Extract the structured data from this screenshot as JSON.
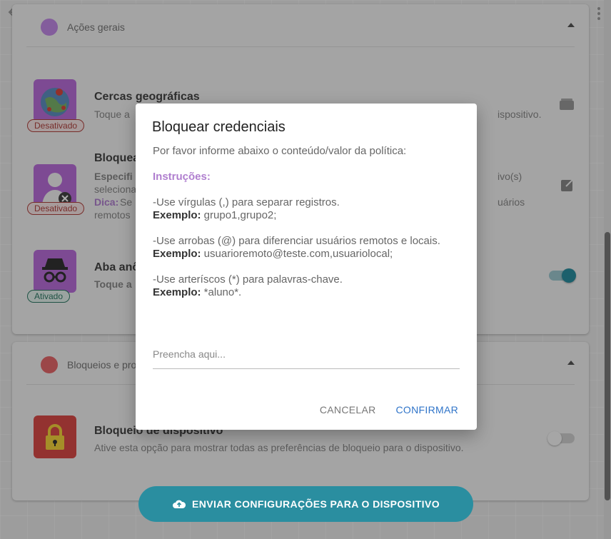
{
  "colors": {
    "accent": "#2a8ea0",
    "dialog_link": "#2f74c9",
    "instructions": "#b07fcf",
    "badge_off": "#b0433f",
    "badge_on": "#2f7a66",
    "section_general": "#c189e6",
    "section_blocks": "#e5676a"
  },
  "sections": [
    {
      "label": "Ações gerais",
      "items": [
        {
          "title": "Cercas geográficas",
          "desc_visible_prefix": "Toque a",
          "desc_visible_suffix": "ispositivo.",
          "badge": "Desativado",
          "icon": "map-globe-icon"
        },
        {
          "title": "Bloquea",
          "desc_line1_prefix": "Especifi",
          "desc_line1_suffix": "ivo(s)",
          "desc_line2": "seleciona",
          "tip_label": "Dica:",
          "tip_prefix": "Se",
          "tip_suffix": "uários",
          "desc_line4": "remotos",
          "badge": "Desativado",
          "icon": "user-blocked-icon"
        },
        {
          "title": "Aba anô",
          "desc_visible_prefix": "Toque a",
          "badge": "Ativado",
          "icon": "incognito-icon",
          "toggle_on": true
        }
      ]
    },
    {
      "label": "Bloqueios e proteç",
      "items": [
        {
          "title": "Bloqueio de dispositivo",
          "desc": "Ative esta opção para mostrar todas as preferências de bloqueio para o dispositivo.",
          "icon": "lock-icon",
          "toggle_on": false
        }
      ]
    }
  ],
  "fab_label": "ENVIAR CONFIGURAÇÕES PARA O DISPOSITIVO",
  "dialog": {
    "title": "Bloquear credenciais",
    "intro": "Por favor informe abaixo o conteúdo/valor da política:",
    "instructions_label": "Instruções:",
    "rules": [
      {
        "text": "-Use vírgulas (,) para separar registros.",
        "example_label": "Exemplo:",
        "example": " grupo1,grupo2;"
      },
      {
        "text": "-Use arrobas (@) para diferenciar usuários remotos e locais.",
        "example_label": "Exemplo:",
        "example": " usuarioremoto@teste.com,usuariolocal;"
      },
      {
        "text": "-Use arteríscos (*) para palavras-chave.",
        "example_label": "Exemplo:",
        "example": " *aluno*."
      }
    ],
    "input_placeholder": "Preencha aqui...",
    "input_value": "",
    "cancel_label": "CANCELAR",
    "confirm_label": "CONFIRMAR"
  }
}
